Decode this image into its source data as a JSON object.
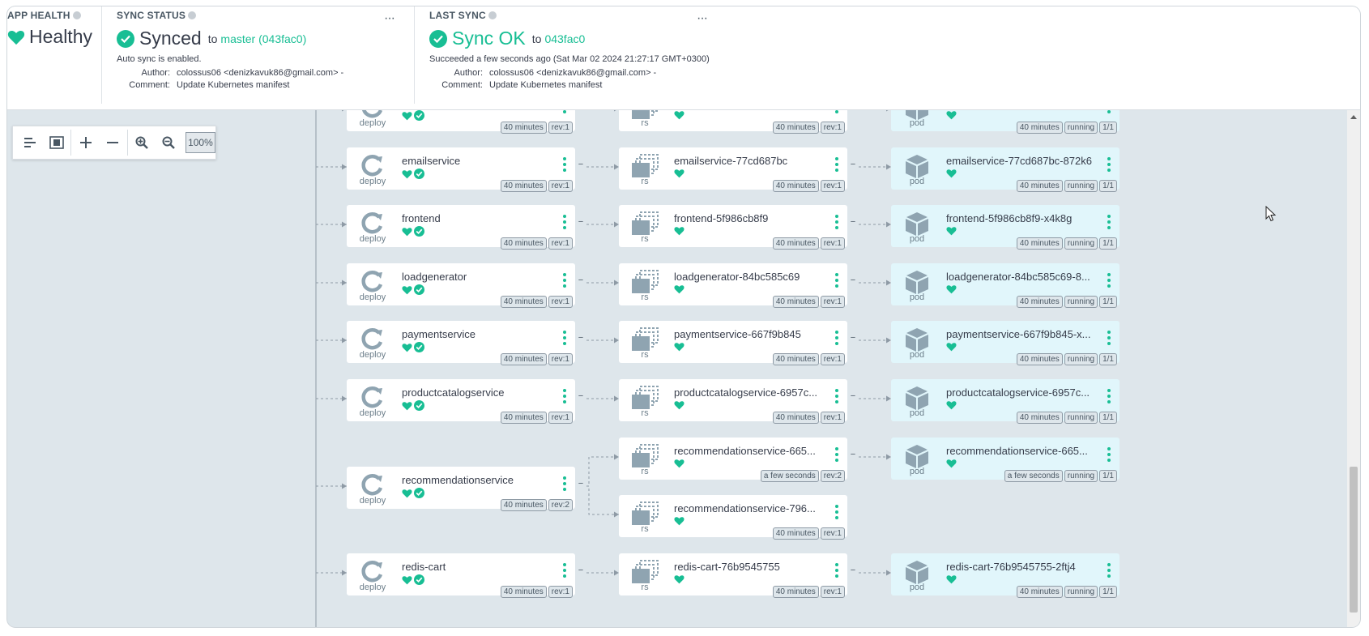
{
  "header": {
    "app_health": {
      "title": "APP HEALTH",
      "status": "Healthy"
    },
    "sync_status": {
      "title": "SYNC STATUS",
      "status": "Synced",
      "to": "to",
      "revision": "master (043fac0)",
      "auto_sync": "Auto sync is enabled.",
      "author_label": "Author:",
      "author": "colossus06 <denizkavuk86@gmail.com> -",
      "comment_label": "Comment:",
      "comment": "Update Kubernetes manifest",
      "more": "···"
    },
    "last_sync": {
      "title": "LAST SYNC",
      "status": "Sync OK",
      "to": "to",
      "revision": "043fac0",
      "succeeded": "Succeeded a few seconds ago (Sat Mar 02 2024 21:27:17 GMT+0300)",
      "author_label": "Author:",
      "author": "colossus06 <denizkavuk86@gmail.com> -",
      "comment_label": "Comment:",
      "comment": "Update Kubernetes manifest",
      "more": "···"
    }
  },
  "toolbar": {
    "zoom": "100%"
  },
  "colors": {
    "accent": "#18be94",
    "canvas": "#dee6eb",
    "pod_bg": "#e1f6fb"
  },
  "rows": [
    {
      "deploy": {
        "name": "",
        "kind": "deploy",
        "age": "40 minutes",
        "rev": "rev:1"
      },
      "rs": [
        {
          "name": "",
          "kind": "rs",
          "age": "40 minutes",
          "rev": "rev:1"
        }
      ],
      "pod": {
        "name": "",
        "kind": "pod",
        "age": "40 minutes",
        "status": "running",
        "ready": "1/1"
      }
    },
    {
      "deploy": {
        "name": "emailservice",
        "kind": "deploy",
        "age": "40 minutes",
        "rev": "rev:1"
      },
      "rs": [
        {
          "name": "emailservice-77cd687bc",
          "kind": "rs",
          "age": "40 minutes",
          "rev": "rev:1"
        }
      ],
      "pod": {
        "name": "emailservice-77cd687bc-872k6",
        "kind": "pod",
        "age": "40 minutes",
        "status": "running",
        "ready": "1/1"
      }
    },
    {
      "deploy": {
        "name": "frontend",
        "kind": "deploy",
        "age": "40 minutes",
        "rev": "rev:1"
      },
      "rs": [
        {
          "name": "frontend-5f986cb8f9",
          "kind": "rs",
          "age": "40 minutes",
          "rev": "rev:1"
        }
      ],
      "pod": {
        "name": "frontend-5f986cb8f9-x4k8g",
        "kind": "pod",
        "age": "40 minutes",
        "status": "running",
        "ready": "1/1"
      }
    },
    {
      "deploy": {
        "name": "loadgenerator",
        "kind": "deploy",
        "age": "40 minutes",
        "rev": "rev:1"
      },
      "rs": [
        {
          "name": "loadgenerator-84bc585c69",
          "kind": "rs",
          "age": "40 minutes",
          "rev": "rev:1"
        }
      ],
      "pod": {
        "name": "loadgenerator-84bc585c69-8...",
        "kind": "pod",
        "age": "40 minutes",
        "status": "running",
        "ready": "1/1"
      }
    },
    {
      "deploy": {
        "name": "paymentservice",
        "kind": "deploy",
        "age": "40 minutes",
        "rev": "rev:1"
      },
      "rs": [
        {
          "name": "paymentservice-667f9b845",
          "kind": "rs",
          "age": "40 minutes",
          "rev": "rev:1"
        }
      ],
      "pod": {
        "name": "paymentservice-667f9b845-x...",
        "kind": "pod",
        "age": "40 minutes",
        "status": "running",
        "ready": "1/1"
      }
    },
    {
      "deploy": {
        "name": "productcatalogservice",
        "kind": "deploy",
        "age": "40 minutes",
        "rev": "rev:1"
      },
      "rs": [
        {
          "name": "productcatalogservice-6957c...",
          "kind": "rs",
          "age": "40 minutes",
          "rev": "rev:1"
        }
      ],
      "pod": {
        "name": "productcatalogservice-6957c...",
        "kind": "pod",
        "age": "40 minutes",
        "status": "running",
        "ready": "1/1"
      }
    },
    {
      "deploy": {
        "name": "recommendationservice",
        "kind": "deploy",
        "age": "40 minutes",
        "rev": "rev:2"
      },
      "rs": [
        {
          "name": "recommendationservice-665...",
          "kind": "rs",
          "age": "a few seconds",
          "rev": "rev:2"
        },
        {
          "name": "recommendationservice-796...",
          "kind": "rs",
          "age": "40 minutes",
          "rev": "rev:1"
        }
      ],
      "pod": {
        "name": "recommendationservice-665...",
        "kind": "pod",
        "age": "a few seconds",
        "status": "running",
        "ready": "1/1"
      }
    },
    {
      "deploy": {
        "name": "redis-cart",
        "kind": "deploy",
        "age": "40 minutes",
        "rev": "rev:1"
      },
      "rs": [
        {
          "name": "redis-cart-76b9545755",
          "kind": "rs",
          "age": "40 minutes",
          "rev": "rev:1"
        }
      ],
      "pod": {
        "name": "redis-cart-76b9545755-2ftj4",
        "kind": "pod",
        "age": "40 minutes",
        "status": "running",
        "ready": "1/1"
      }
    }
  ]
}
